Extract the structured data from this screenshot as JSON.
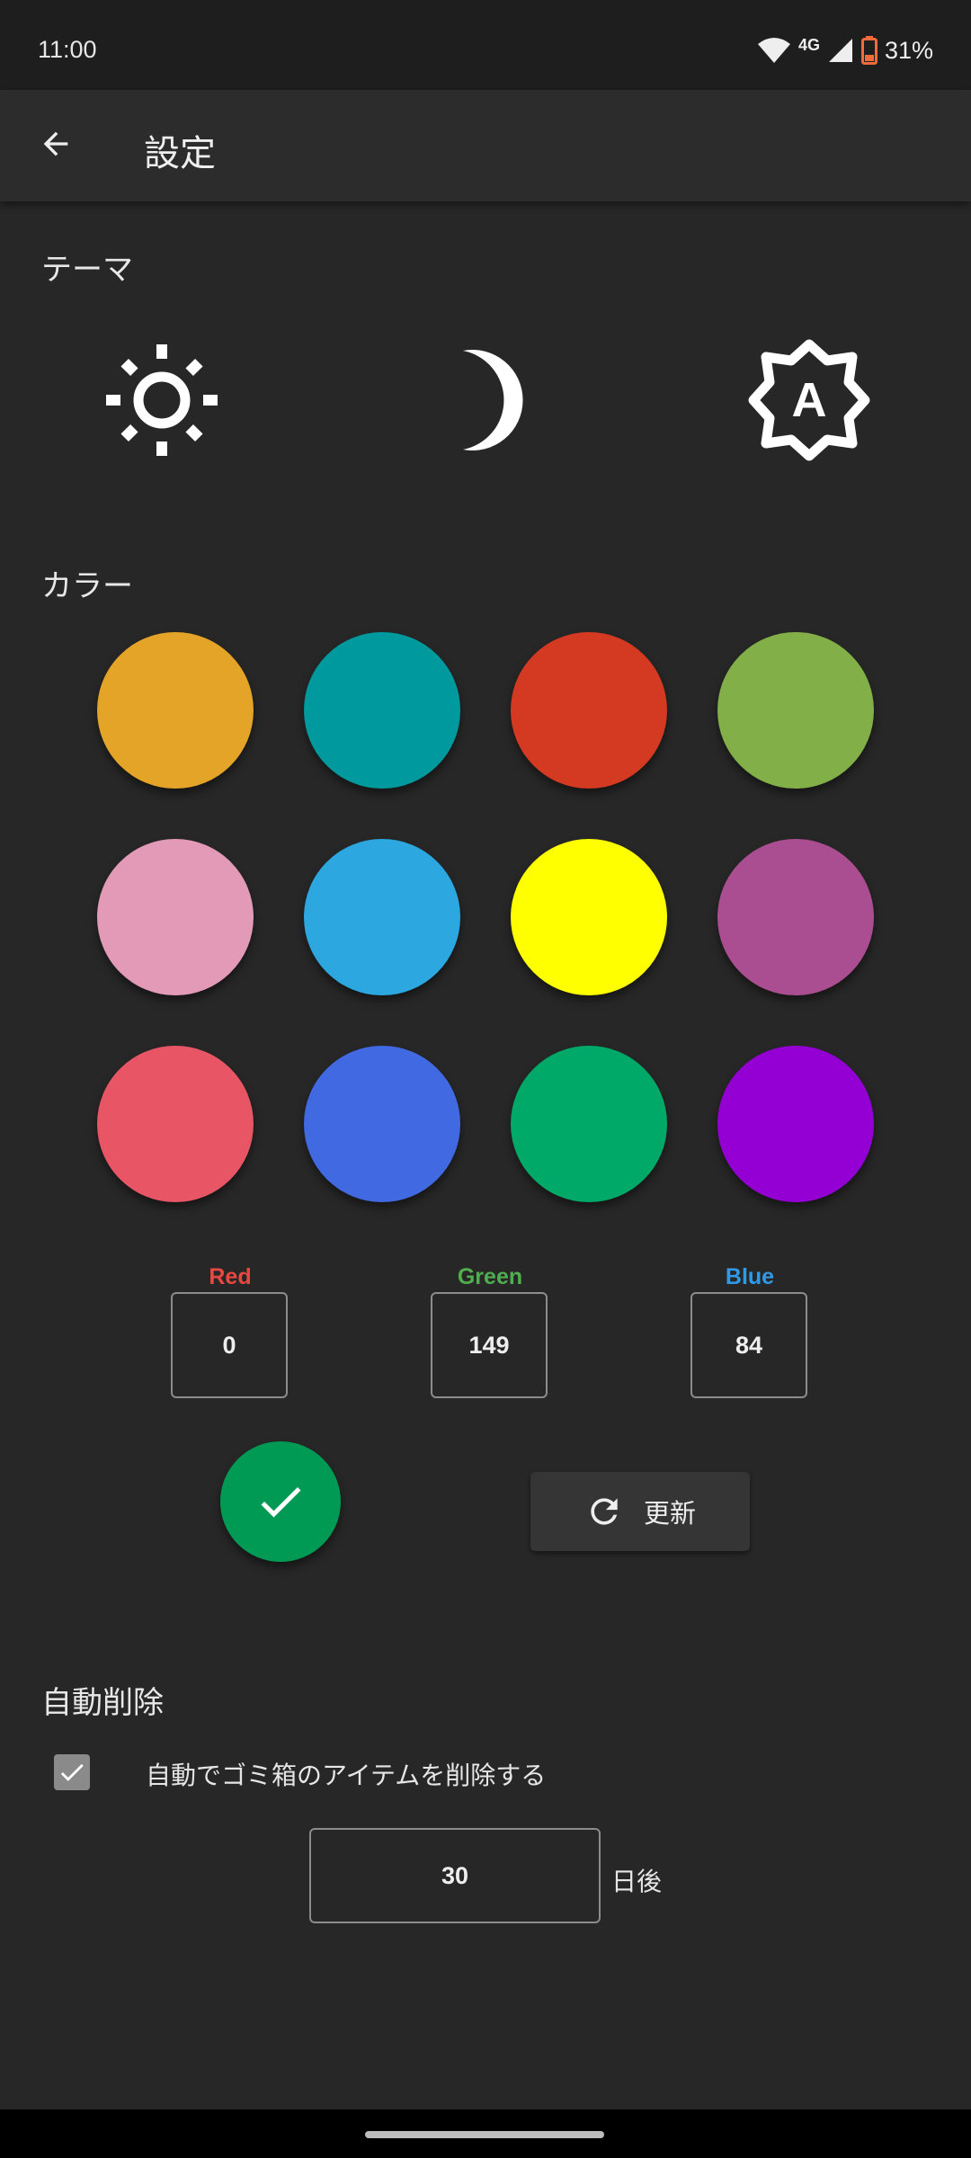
{
  "status_bar": {
    "time": "11:00",
    "network": "4G",
    "battery": "31%",
    "battery_color": "#F36B3A"
  },
  "app_bar": {
    "back_icon": "arrow-left-icon",
    "title": "設定"
  },
  "theme": {
    "title": "テーマ",
    "options": [
      {
        "name": "light",
        "icon": "sun-icon"
      },
      {
        "name": "dark",
        "icon": "moon-icon"
      },
      {
        "name": "auto",
        "icon": "brightness-auto-icon"
      }
    ]
  },
  "color": {
    "title": "カラー",
    "swatches": [
      "#E4A427",
      "#00999E",
      "#D43A21",
      "#82AF47",
      "#E29AB6",
      "#2CA7E0",
      "#FFFF00",
      "#AA4E91",
      "#E85565",
      "#4169E1",
      "#00A968",
      "#9400D3"
    ],
    "rgb": {
      "red": {
        "label": "Red",
        "value": "0",
        "color": "#E8483F"
      },
      "green": {
        "label": "Green",
        "value": "149",
        "color": "#4FAE4E"
      },
      "blue": {
        "label": "Blue",
        "value": "84",
        "color": "#2F9AE8"
      }
    },
    "preview_color": "#009A55",
    "apply_icon": "check-icon",
    "refresh": {
      "icon": "refresh-icon",
      "label": "更新"
    }
  },
  "auto_delete": {
    "title": "自動削除",
    "checkbox_checked": true,
    "checkbox_label": "自動でゴミ箱のアイテムを削除する",
    "days": "30",
    "days_suffix": "日後"
  }
}
